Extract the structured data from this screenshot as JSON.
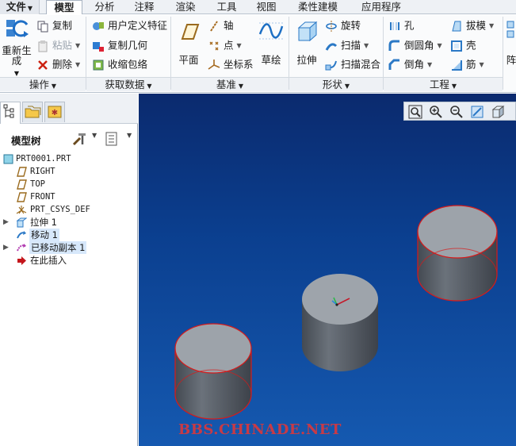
{
  "tabs": {
    "file": "文件",
    "model": "模型",
    "analysis": "分析",
    "annotation": "注释",
    "render": "渲染",
    "tools": "工具",
    "view": "视图",
    "flexible": "柔性建模",
    "apps": "应用程序"
  },
  "ribbon": {
    "operations": {
      "label": "操作",
      "regenerate": "重新生成",
      "copy": "复制",
      "paste": "粘贴",
      "delete": "删除"
    },
    "get_data": {
      "label": "获取数据",
      "udf": "用户定义特征",
      "copy_geom": "复制几何",
      "shrinkwrap": "收缩包络"
    },
    "datum": {
      "label": "基准",
      "plane": "平面",
      "axis": "轴",
      "point": "点",
      "csys": "坐标系",
      "sketch": "草绘"
    },
    "shapes": {
      "label": "形状",
      "extrude": "拉伸",
      "revolve": "旋转",
      "sweep": "扫描",
      "swept_blend": "扫描混合"
    },
    "engineering": {
      "label": "工程",
      "hole": "孔",
      "round": "倒圆角",
      "chamfer": "倒角",
      "draft": "拔模",
      "shell": "壳",
      "rib": "筋"
    },
    "cut_label": "阵"
  },
  "tree": {
    "title": "模型树",
    "nodes": [
      {
        "label": "PRT0001.PRT"
      },
      {
        "label": "RIGHT"
      },
      {
        "label": "TOP"
      },
      {
        "label": "FRONT"
      },
      {
        "label": "PRT_CSYS_DEF"
      },
      {
        "label": "拉伸 1"
      },
      {
        "label": "移动 1"
      },
      {
        "label": "已移动副本 1"
      },
      {
        "label": "在此插入"
      }
    ]
  },
  "viewport": {
    "watermark": "BBS.CHINADE.NET",
    "background_top": "#0b2a6e",
    "background_bottom": "#1559b0",
    "cylinder_color": "#5e6570",
    "edge_color": "#d81a1a"
  }
}
